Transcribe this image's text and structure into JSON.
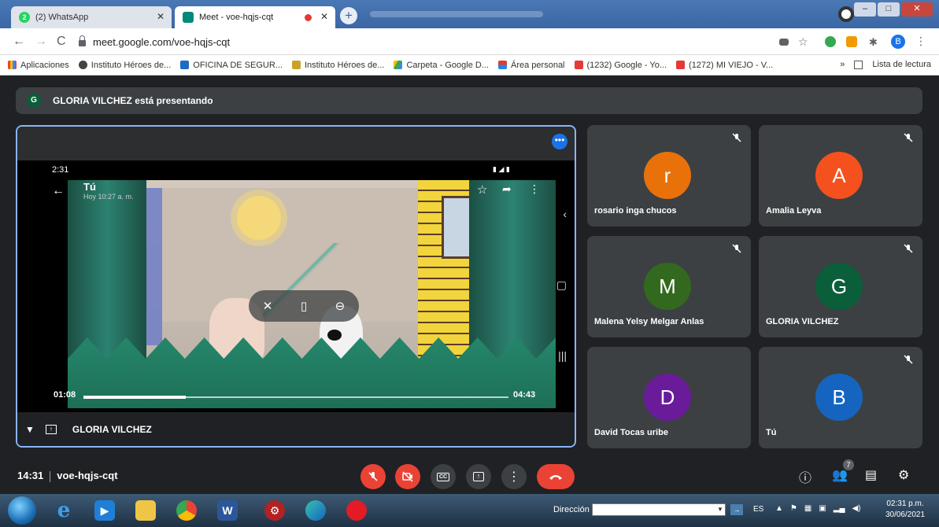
{
  "browser": {
    "tabs": [
      {
        "title": "(2) WhatsApp",
        "badge": "2",
        "active": false
      },
      {
        "title": "Meet - voe-hqjs-cqt",
        "active": true
      }
    ],
    "url": "meet.google.com/voe-hqjs-cqt",
    "profile_initial": "B",
    "bookmarks": [
      "Aplicaciones",
      "Instituto Héroes de...",
      "OFICINA DE SEGUR...",
      "Instituto Héroes de...",
      "Carpeta - Google D...",
      "Área personal",
      "(1232) Google - Yo...",
      "(1272) MI VIEJO - V..."
    ],
    "overflow": "»",
    "reading_list": "Lista de lectura"
  },
  "meet": {
    "presenting_initial": "G",
    "presenting_text": "GLORIA VILCHEZ está presentando",
    "main": {
      "presenter": "GLORIA VILCHEZ",
      "phone_time": "2:31",
      "video_title": "Tú",
      "video_subtitle": "Hoy 10:27 a. m.",
      "time_current": "01:08",
      "time_total": "04:43",
      "progress_fraction": 0.24
    },
    "participants": [
      {
        "initial": "r",
        "name": "rosario inga chucos",
        "color": "#e8710a",
        "muted": true
      },
      {
        "initial": "A",
        "name": "Amalia Leyva",
        "color": "#f4511e",
        "muted": true
      },
      {
        "initial": "M",
        "name": "Malena Yelsy Melgar Anlas",
        "color": "#33691e",
        "muted": true
      },
      {
        "initial": "G",
        "name": "GLORIA VILCHEZ",
        "color": "#0b5e3a",
        "muted": true
      },
      {
        "initial": "D",
        "name": "David Tocas uribe",
        "color": "#6a1b9a",
        "muted": false
      },
      {
        "initial": "B",
        "name": "Tú",
        "color": "#1565c0",
        "muted": true
      }
    ],
    "meeting_time": "14:31",
    "meeting_code": "voe-hqjs-cqt",
    "people_count": "7"
  },
  "taskbar": {
    "address_label": "Dirección",
    "language": "ES",
    "clock_time": "02:31 p.m.",
    "clock_date": "30/06/2021"
  }
}
